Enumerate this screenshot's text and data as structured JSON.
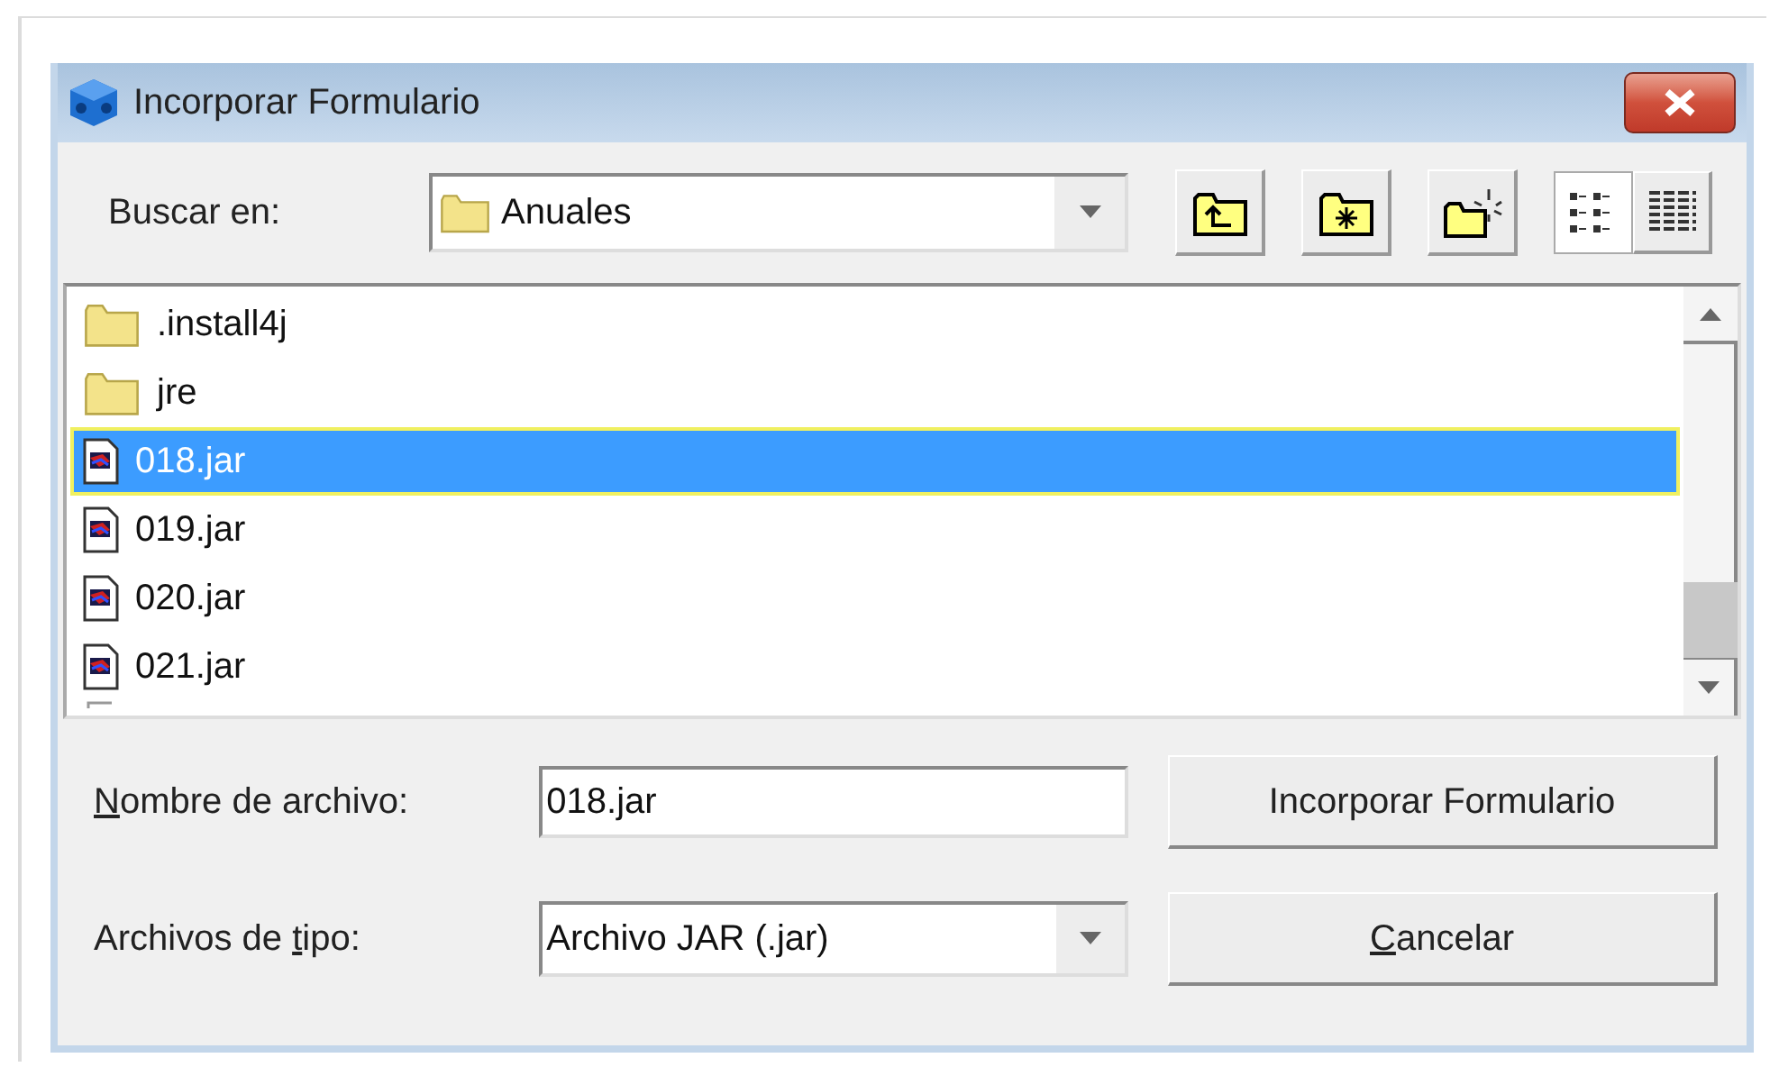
{
  "window": {
    "title": "Incorporar Formulario"
  },
  "look_in": {
    "label": "Buscar en:",
    "value": "Anuales"
  },
  "toolbar": {
    "view_buttons": [
      {
        "kind": "list",
        "selected": true
      },
      {
        "kind": "details",
        "selected": false
      }
    ]
  },
  "files": [
    {
      "name": ".install4j",
      "kind": "folder",
      "selected": false
    },
    {
      "name": "jre",
      "kind": "folder",
      "selected": false
    },
    {
      "name": "018.jar",
      "kind": "jar",
      "selected": true
    },
    {
      "name": "019.jar",
      "kind": "jar",
      "selected": false
    },
    {
      "name": "020.jar",
      "kind": "jar",
      "selected": false
    },
    {
      "name": "021.jar",
      "kind": "jar",
      "selected": false
    }
  ],
  "file_name": {
    "label": {
      "key": "N",
      "rest_after": "ombre de archivo:"
    },
    "value": "018.jar"
  },
  "file_type": {
    "label": {
      "key": "t",
      "rest_before": "Archivos de ",
      "rest_after": "ipo:"
    },
    "value": "Archivo JAR (.jar)"
  },
  "buttons": [
    {
      "kind": "plain",
      "label": "Incorporar Formulario"
    },
    {
      "kind": "mnemonic",
      "key": "C",
      "rest": "ancelar"
    }
  ]
}
